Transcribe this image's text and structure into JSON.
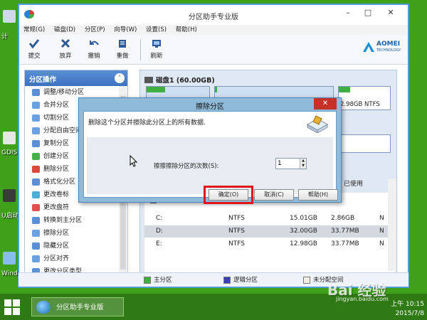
{
  "desktop": {
    "icons": [
      {
        "label": "计",
        "color": "#cfd8e8"
      },
      {
        "label": "GDIS",
        "color": "#e6e6e6"
      },
      {
        "label": "U启动",
        "color": "#3a3a3a"
      },
      {
        "label": "Wind",
        "color": "#88bbee"
      }
    ]
  },
  "window": {
    "title": "分区助手专业版",
    "menu": [
      "常规(G)",
      "磁盘(D)",
      "分区(P)",
      "向导(W)",
      "设置(S)",
      "帮助(H)"
    ],
    "toolbar": [
      "提交",
      "放弃",
      "撤销",
      "重做",
      "刷新"
    ],
    "logo": {
      "name": "AOMEI",
      "sub": "TECHNOLOGY"
    }
  },
  "left_panel": {
    "title": "分区操作",
    "items": [
      {
        "label": "调整/移动分区",
        "icon": "resize-icon"
      },
      {
        "label": "合并分区",
        "icon": "merge-icon"
      },
      {
        "label": "切割分区",
        "icon": "split-icon"
      },
      {
        "label": "分配自由空间",
        "icon": "allocate-icon"
      },
      {
        "label": "复制分区",
        "icon": "copy-icon"
      },
      {
        "label": "创建分区",
        "icon": "create-icon"
      },
      {
        "label": "删除分区",
        "icon": "delete-icon"
      },
      {
        "label": "格式化分区",
        "icon": "format-icon"
      },
      {
        "label": "更改卷标",
        "icon": "label-icon"
      },
      {
        "label": "更改盘符",
        "icon": "drive-letter-icon"
      },
      {
        "label": "转换到主分区",
        "icon": "convert-icon"
      },
      {
        "label": "擦除分区",
        "icon": "wipe-icon"
      },
      {
        "label": "隐藏分区",
        "icon": "hide-icon"
      },
      {
        "label": "分区对齐",
        "icon": "align-icon"
      },
      {
        "label": "更改分区类型",
        "icon": "type-icon"
      }
    ]
  },
  "disk": {
    "header": "磁盘1 (60.00GB)",
    "visible_info": "2.98GB NTFS",
    "used_header": "已使用",
    "table_label": "盘1",
    "rows": [
      {
        "drive": "C:",
        "fs": "NTFS",
        "capacity": "15.01GB",
        "used": "2.86GB",
        "flag": "N"
      },
      {
        "drive": "D:",
        "fs": "NTFS",
        "capacity": "32.00GB",
        "used": "33.77MB",
        "flag": "N",
        "selected": true
      },
      {
        "drive": "E:",
        "fs": "NTFS",
        "capacity": "12.98GB",
        "used": "33.77MB",
        "flag": "N"
      }
    ]
  },
  "legend": [
    {
      "label": "主分区",
      "color": "#3fb040"
    },
    {
      "label": "逻辑分区",
      "color": "#3d3dbb"
    },
    {
      "label": "未分配空间",
      "color": "#f2efe4"
    }
  ],
  "dialog": {
    "title": "擦除分区",
    "close": "✕",
    "message": "删除这个分区并擦除此分区上的所有数据.",
    "times_label": "擦擦擦除分区的次数(S):",
    "times_value": "1",
    "buttons": {
      "ok": "确定(O)",
      "cancel": "取消(C)",
      "help": "帮助(H)"
    }
  },
  "taskbar": {
    "item": "分区助手专业版",
    "time": "上午 10:15",
    "date": "2015/7/8"
  },
  "watermark": {
    "brand": "Bai 经验",
    "url": "jingyan.baidu.com"
  },
  "colors": {
    "accent": "#3c72c0",
    "highlight": "#e0141a",
    "desktop": "#3fa01a"
  }
}
